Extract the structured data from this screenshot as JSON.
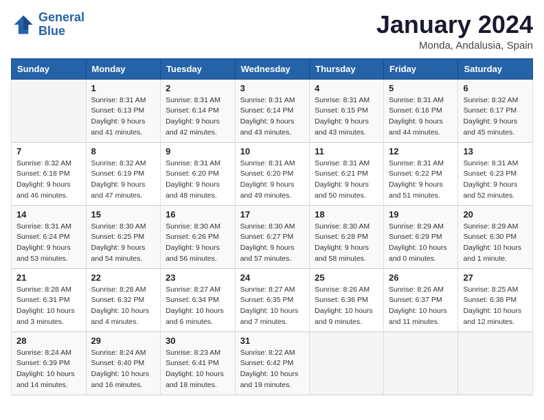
{
  "header": {
    "logo_line1": "General",
    "logo_line2": "Blue",
    "title": "January 2024",
    "subtitle": "Monda, Andalusia, Spain"
  },
  "columns": [
    "Sunday",
    "Monday",
    "Tuesday",
    "Wednesday",
    "Thursday",
    "Friday",
    "Saturday"
  ],
  "weeks": [
    [
      {
        "day": "",
        "sunrise": "",
        "sunset": "",
        "daylight": ""
      },
      {
        "day": "1",
        "sunrise": "Sunrise: 8:31 AM",
        "sunset": "Sunset: 6:13 PM",
        "daylight": "Daylight: 9 hours and 41 minutes."
      },
      {
        "day": "2",
        "sunrise": "Sunrise: 8:31 AM",
        "sunset": "Sunset: 6:14 PM",
        "daylight": "Daylight: 9 hours and 42 minutes."
      },
      {
        "day": "3",
        "sunrise": "Sunrise: 8:31 AM",
        "sunset": "Sunset: 6:14 PM",
        "daylight": "Daylight: 9 hours and 43 minutes."
      },
      {
        "day": "4",
        "sunrise": "Sunrise: 8:31 AM",
        "sunset": "Sunset: 6:15 PM",
        "daylight": "Daylight: 9 hours and 43 minutes."
      },
      {
        "day": "5",
        "sunrise": "Sunrise: 8:31 AM",
        "sunset": "Sunset: 6:16 PM",
        "daylight": "Daylight: 9 hours and 44 minutes."
      },
      {
        "day": "6",
        "sunrise": "Sunrise: 8:32 AM",
        "sunset": "Sunset: 6:17 PM",
        "daylight": "Daylight: 9 hours and 45 minutes."
      }
    ],
    [
      {
        "day": "7",
        "sunrise": "Sunrise: 8:32 AM",
        "sunset": "Sunset: 6:18 PM",
        "daylight": "Daylight: 9 hours and 46 minutes."
      },
      {
        "day": "8",
        "sunrise": "Sunrise: 8:32 AM",
        "sunset": "Sunset: 6:19 PM",
        "daylight": "Daylight: 9 hours and 47 minutes."
      },
      {
        "day": "9",
        "sunrise": "Sunrise: 8:31 AM",
        "sunset": "Sunset: 6:20 PM",
        "daylight": "Daylight: 9 hours and 48 minutes."
      },
      {
        "day": "10",
        "sunrise": "Sunrise: 8:31 AM",
        "sunset": "Sunset: 6:20 PM",
        "daylight": "Daylight: 9 hours and 49 minutes."
      },
      {
        "day": "11",
        "sunrise": "Sunrise: 8:31 AM",
        "sunset": "Sunset: 6:21 PM",
        "daylight": "Daylight: 9 hours and 50 minutes."
      },
      {
        "day": "12",
        "sunrise": "Sunrise: 8:31 AM",
        "sunset": "Sunset: 6:22 PM",
        "daylight": "Daylight: 9 hours and 51 minutes."
      },
      {
        "day": "13",
        "sunrise": "Sunrise: 8:31 AM",
        "sunset": "Sunset: 6:23 PM",
        "daylight": "Daylight: 9 hours and 52 minutes."
      }
    ],
    [
      {
        "day": "14",
        "sunrise": "Sunrise: 8:31 AM",
        "sunset": "Sunset: 6:24 PM",
        "daylight": "Daylight: 9 hours and 53 minutes."
      },
      {
        "day": "15",
        "sunrise": "Sunrise: 8:30 AM",
        "sunset": "Sunset: 6:25 PM",
        "daylight": "Daylight: 9 hours and 54 minutes."
      },
      {
        "day": "16",
        "sunrise": "Sunrise: 8:30 AM",
        "sunset": "Sunset: 6:26 PM",
        "daylight": "Daylight: 9 hours and 56 minutes."
      },
      {
        "day": "17",
        "sunrise": "Sunrise: 8:30 AM",
        "sunset": "Sunset: 6:27 PM",
        "daylight": "Daylight: 9 hours and 57 minutes."
      },
      {
        "day": "18",
        "sunrise": "Sunrise: 8:30 AM",
        "sunset": "Sunset: 6:28 PM",
        "daylight": "Daylight: 9 hours and 58 minutes."
      },
      {
        "day": "19",
        "sunrise": "Sunrise: 8:29 AM",
        "sunset": "Sunset: 6:29 PM",
        "daylight": "Daylight: 10 hours and 0 minutes."
      },
      {
        "day": "20",
        "sunrise": "Sunrise: 8:29 AM",
        "sunset": "Sunset: 6:30 PM",
        "daylight": "Daylight: 10 hours and 1 minute."
      }
    ],
    [
      {
        "day": "21",
        "sunrise": "Sunrise: 8:28 AM",
        "sunset": "Sunset: 6:31 PM",
        "daylight": "Daylight: 10 hours and 3 minutes."
      },
      {
        "day": "22",
        "sunrise": "Sunrise: 8:28 AM",
        "sunset": "Sunset: 6:32 PM",
        "daylight": "Daylight: 10 hours and 4 minutes."
      },
      {
        "day": "23",
        "sunrise": "Sunrise: 8:27 AM",
        "sunset": "Sunset: 6:34 PM",
        "daylight": "Daylight: 10 hours and 6 minutes."
      },
      {
        "day": "24",
        "sunrise": "Sunrise: 8:27 AM",
        "sunset": "Sunset: 6:35 PM",
        "daylight": "Daylight: 10 hours and 7 minutes."
      },
      {
        "day": "25",
        "sunrise": "Sunrise: 8:26 AM",
        "sunset": "Sunset: 6:36 PM",
        "daylight": "Daylight: 10 hours and 9 minutes."
      },
      {
        "day": "26",
        "sunrise": "Sunrise: 8:26 AM",
        "sunset": "Sunset: 6:37 PM",
        "daylight": "Daylight: 10 hours and 11 minutes."
      },
      {
        "day": "27",
        "sunrise": "Sunrise: 8:25 AM",
        "sunset": "Sunset: 6:38 PM",
        "daylight": "Daylight: 10 hours and 12 minutes."
      }
    ],
    [
      {
        "day": "28",
        "sunrise": "Sunrise: 8:24 AM",
        "sunset": "Sunset: 6:39 PM",
        "daylight": "Daylight: 10 hours and 14 minutes."
      },
      {
        "day": "29",
        "sunrise": "Sunrise: 8:24 AM",
        "sunset": "Sunset: 6:40 PM",
        "daylight": "Daylight: 10 hours and 16 minutes."
      },
      {
        "day": "30",
        "sunrise": "Sunrise: 8:23 AM",
        "sunset": "Sunset: 6:41 PM",
        "daylight": "Daylight: 10 hours and 18 minutes."
      },
      {
        "day": "31",
        "sunrise": "Sunrise: 8:22 AM",
        "sunset": "Sunset: 6:42 PM",
        "daylight": "Daylight: 10 hours and 19 minutes."
      },
      {
        "day": "",
        "sunrise": "",
        "sunset": "",
        "daylight": ""
      },
      {
        "day": "",
        "sunrise": "",
        "sunset": "",
        "daylight": ""
      },
      {
        "day": "",
        "sunrise": "",
        "sunset": "",
        "daylight": ""
      }
    ]
  ]
}
